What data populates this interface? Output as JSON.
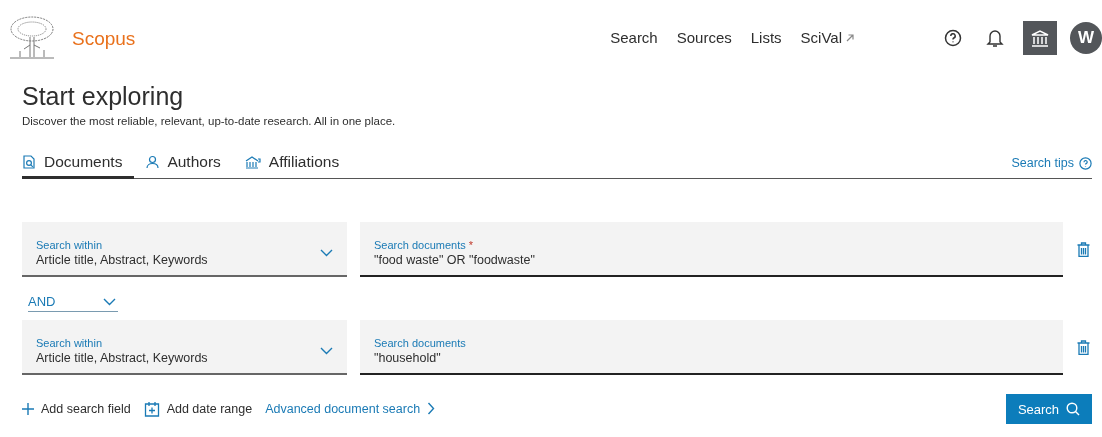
{
  "header": {
    "brand": "Scopus",
    "nav": [
      {
        "label": "Search",
        "external": false
      },
      {
        "label": "Sources",
        "external": false
      },
      {
        "label": "Lists",
        "external": false
      },
      {
        "label": "SciVal",
        "external": true
      }
    ],
    "avatar": "W"
  },
  "page": {
    "title": "Start exploring",
    "subtitle": "Discover the most reliable, relevant, up-to-date research. All in one place."
  },
  "tabs": [
    {
      "label": "Documents",
      "kind": "documents",
      "selected": true
    },
    {
      "label": "Authors",
      "kind": "person",
      "selected": false
    },
    {
      "label": "Affiliations",
      "kind": "building",
      "selected": false
    }
  ],
  "search_tips": "Search tips",
  "rows": [
    {
      "within_label": "Search within",
      "within_value": "Article title, Abstract, Keywords",
      "query_label": "Search documents",
      "required_mark": "*",
      "query_value": "\"food waste\" OR \"foodwaste\""
    },
    {
      "operator": "AND",
      "within_label": "Search within",
      "within_value": "Article title, Abstract, Keywords",
      "query_label": "Search documents",
      "query_value": "\"household\""
    }
  ],
  "actions": [
    {
      "label": "Add search field",
      "kind": "plus"
    },
    {
      "label": "Add date range",
      "kind": "calendar"
    },
    {
      "label": "Advanced document search",
      "kind": "link"
    }
  ],
  "search_button": "Search"
}
